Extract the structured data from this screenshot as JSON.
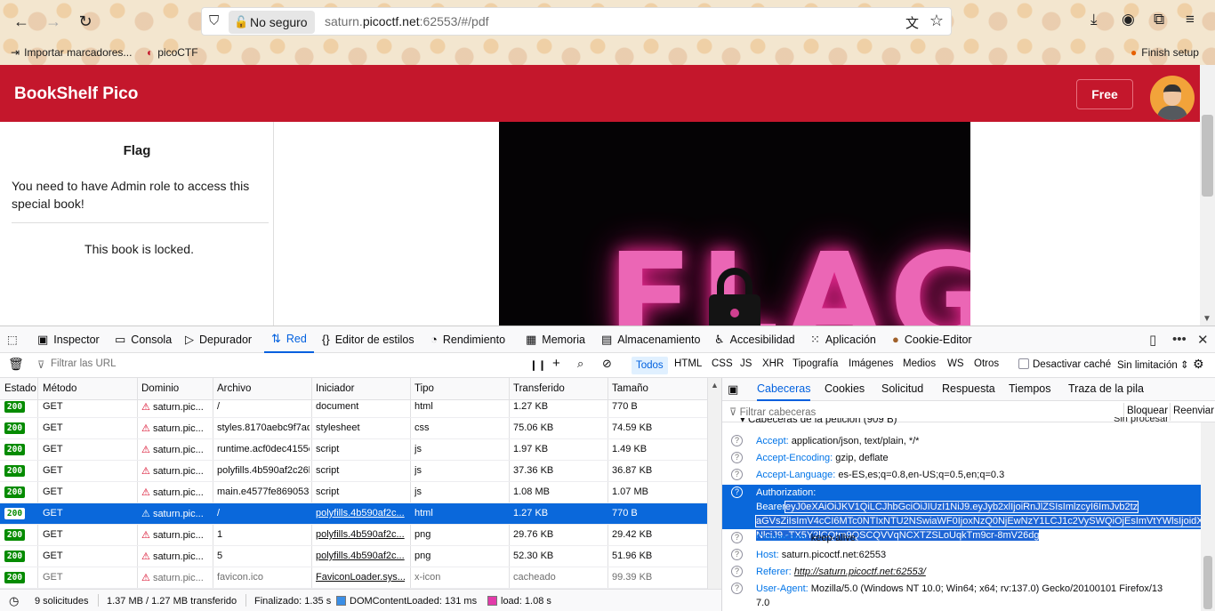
{
  "browser": {
    "security_label": "No seguro",
    "url_prefix": "saturn.",
    "url_host": "picoctf.net",
    "url_suffix": ":62553/#/pdf",
    "bookmarks": [
      {
        "label": "Importar marcadores...",
        "icon": "import-icon"
      },
      {
        "label": "picoCTF",
        "icon": "picoctf-icon"
      }
    ],
    "finish_setup": "Finish setup"
  },
  "app": {
    "title": "BookShelf Pico",
    "free_label": "Free",
    "colors": {
      "header": "#c4172c"
    }
  },
  "left_panel": {
    "title": "Flag",
    "message": "You need to have Admin role to access this special book!",
    "locked": "This book is locked."
  },
  "pdf": {
    "flag_text": "FLAG"
  },
  "devtools": {
    "tabs": [
      {
        "label": "Inspector",
        "icon": "inspector-icon"
      },
      {
        "label": "Consola",
        "icon": "console-icon"
      },
      {
        "label": "Depurador",
        "icon": "debugger-icon"
      },
      {
        "label": "Red",
        "icon": "network-icon",
        "active": true
      },
      {
        "label": "Editor de estilos",
        "icon": "style-editor-icon"
      },
      {
        "label": "Rendimiento",
        "icon": "performance-icon"
      },
      {
        "label": "Memoria",
        "icon": "memory-icon"
      },
      {
        "label": "Almacenamiento",
        "icon": "storage-icon"
      },
      {
        "label": "Accesibilidad",
        "icon": "accessibility-icon"
      },
      {
        "label": "Aplicación",
        "icon": "application-icon"
      },
      {
        "label": "Cookie-Editor",
        "icon": "cookie-icon"
      }
    ],
    "filter_placeholder": "Filtrar las URL",
    "type_filters": [
      "Todos",
      "HTML",
      "CSS",
      "JS",
      "XHR",
      "Tipografía",
      "Imágenes",
      "Medios",
      "WS",
      "Otros"
    ],
    "disable_cache": "Desactivar caché",
    "throttle": "Sin limitación",
    "columns": [
      "Estado",
      "Método",
      "Dominio",
      "Archivo",
      "Iniciador",
      "Tipo",
      "Transferido",
      "Tamaño"
    ],
    "requests": [
      {
        "status": "200",
        "method": "GET",
        "domain": "saturn.pic...",
        "file": "/",
        "initiator": "document",
        "type": "html",
        "transferred": "1.27 KB",
        "size": "770 B"
      },
      {
        "status": "200",
        "method": "GET",
        "domain": "saturn.pic...",
        "file": "styles.8170aebc9f7ad7",
        "initiator": "stylesheet",
        "type": "css",
        "transferred": "75.06 KB",
        "size": "74.59 KB"
      },
      {
        "status": "200",
        "method": "GET",
        "domain": "saturn.pic...",
        "file": "runtime.acf0dec4155e",
        "initiator": "script",
        "type": "js",
        "transferred": "1.97 KB",
        "size": "1.49 KB"
      },
      {
        "status": "200",
        "method": "GET",
        "domain": "saturn.pic...",
        "file": "polyfills.4b590af2c26b",
        "initiator": "script",
        "type": "js",
        "transferred": "37.36 KB",
        "size": "36.87 KB"
      },
      {
        "status": "200",
        "method": "GET",
        "domain": "saturn.pic...",
        "file": "main.e4577fe8690537",
        "initiator": "script",
        "type": "js",
        "transferred": "1.08 MB",
        "size": "1.07 MB"
      },
      {
        "status": "200",
        "method": "GET",
        "domain": "saturn.pic...",
        "file": "/",
        "initiator": "polyfills.4b590af2c...",
        "type": "html",
        "transferred": "1.27 KB",
        "size": "770 B"
      },
      {
        "status": "200",
        "method": "GET",
        "domain": "saturn.pic...",
        "file": "1",
        "initiator": "polyfills.4b590af2c...",
        "type": "png",
        "transferred": "29.76 KB",
        "size": "29.42 KB"
      },
      {
        "status": "200",
        "method": "GET",
        "domain": "saturn.pic...",
        "file": "5",
        "initiator": "polyfills.4b590af2c...",
        "type": "png",
        "transferred": "52.30 KB",
        "size": "51.96 KB"
      },
      {
        "status": "200",
        "method": "GET",
        "domain": "saturn.pic...",
        "file": "favicon.ico",
        "initiator": "FaviconLoader.sys....",
        "type": "x-icon",
        "transferred": "cacheado",
        "size": "99.39 KB"
      }
    ],
    "status_bar": {
      "requests": "9 solicitudes",
      "transferred": "1.37 MB / 1.27 MB transferido",
      "finished": "Finalizado: 1.35 s",
      "dom": "DOMContentLoaded: 131 ms",
      "load": "load: 1.08 s"
    },
    "side_tabs": [
      "Cabeceras",
      "Cookies",
      "Solicitud",
      "Respuesta",
      "Tiempos",
      "Traza de la pila"
    ],
    "header_filter_placeholder": "Filtrar cabeceras",
    "block_label": "Bloquear",
    "resend_label": "Reenviar",
    "section_title": "Cabeceras de la petición (909 B)",
    "raw_label": "Sin procesar",
    "headers": [
      {
        "key": "Accept:",
        "value": "application/json, text/plain, */*"
      },
      {
        "key": "Accept-Encoding:",
        "value": "gzip, deflate"
      },
      {
        "key": "Accept-Language:",
        "value": "es-ES,es;q=0.8,en-US;q=0.5,en;q=0.3"
      },
      {
        "key": "Authorization:",
        "value_prefix": "Bearer",
        "value_lines": [
          "eyJ0eXAiOiJKV1QiLCJhbGciOiJIUzI1NiJ9.eyJyb2xlIjoiRnJlZSIsImlzcyI6ImJvb2tz",
          "aGVsZiIsImV4cCI6MTc0NTIxNTU2NSwiaWF0IjoxNzQ0NjEwNzY1LCJ1c2VySWQiOjEsImVtYWlsIjoidX",
          "NlciJ9.-TX5Y2lCQtm9QSCQVVqNCXTZSLoUqkTm9cr-8mV26dg"
        ]
      },
      {
        "key": "Connection:",
        "value": "keep-alive"
      },
      {
        "key": "Host:",
        "value": "saturn.picoctf.net:62553"
      },
      {
        "key": "Referer:",
        "value": "http://saturn.picoctf.net:62553/"
      },
      {
        "key": "User-Agent:",
        "value": "Mozilla/5.0 (Windows NT 10.0; Win64; x64; rv:137.0) Gecko/20100101 Firefox/13",
        "value_cont": "7.0"
      }
    ]
  }
}
